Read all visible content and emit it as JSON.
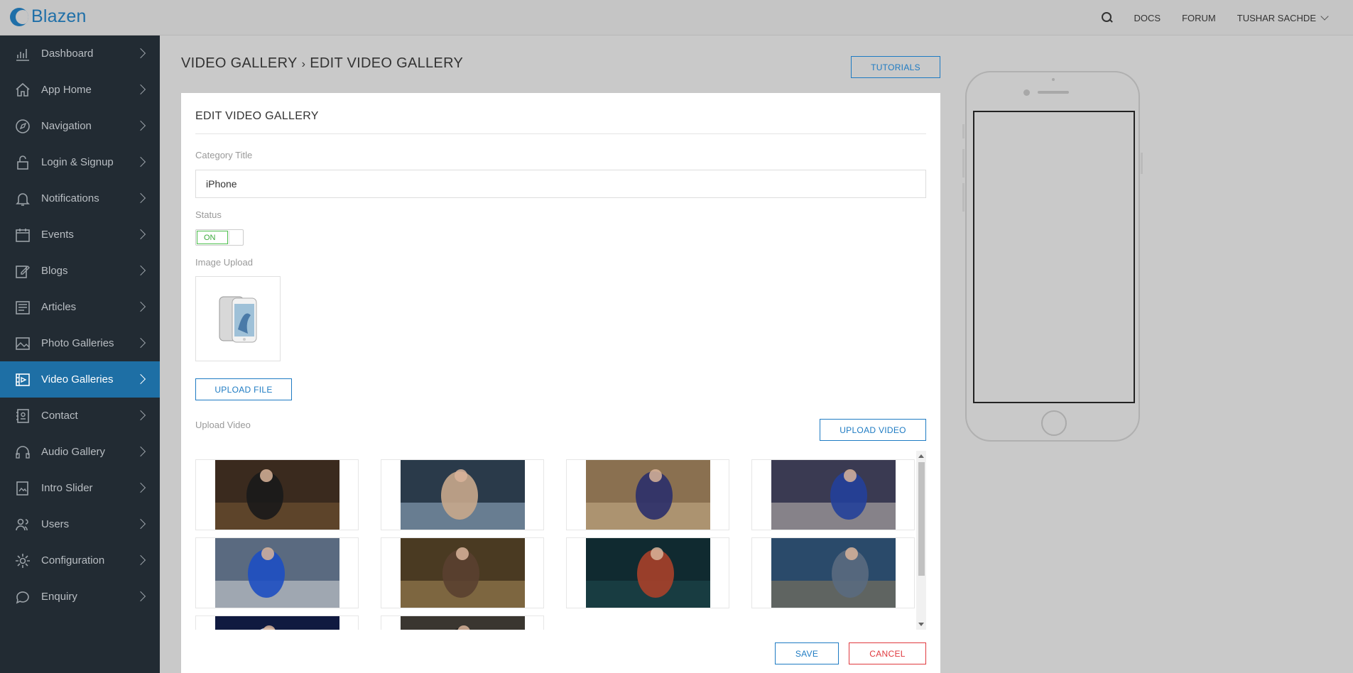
{
  "app": {
    "name": "Blazen",
    "brand_color": "#1f6fa8"
  },
  "topbar": {
    "search_icon": "search-icon",
    "links": [
      "DOCS",
      "FORUM"
    ],
    "user": "TUSHAR SACHDE"
  },
  "sidebar": {
    "active_color": "#1e6fa5",
    "items": [
      {
        "label": "Dashboard",
        "icon": "bar-chart-icon"
      },
      {
        "label": "App Home",
        "icon": "home-icon"
      },
      {
        "label": "Navigation",
        "icon": "compass-icon"
      },
      {
        "label": "Login & Signup",
        "icon": "lock-icon"
      },
      {
        "label": "Notifications",
        "icon": "bell-icon"
      },
      {
        "label": "Events",
        "icon": "calendar-icon"
      },
      {
        "label": "Blogs",
        "icon": "edit-icon"
      },
      {
        "label": "Articles",
        "icon": "newspaper-icon"
      },
      {
        "label": "Photo Galleries",
        "icon": "image-icon"
      },
      {
        "label": "Video Galleries",
        "icon": "film-icon",
        "active": true
      },
      {
        "label": "Contact",
        "icon": "contact-book-icon"
      },
      {
        "label": "Audio Gallery",
        "icon": "headphones-icon"
      },
      {
        "label": "Intro Slider",
        "icon": "slides-icon"
      },
      {
        "label": "Users",
        "icon": "users-icon"
      },
      {
        "label": "Configuration",
        "icon": "gear-icon"
      },
      {
        "label": "Enquiry",
        "icon": "chat-icon"
      }
    ]
  },
  "header": {
    "breadcrumb_parent": "VIDEO GALLERY",
    "breadcrumb_sep": "›",
    "breadcrumb_current": "EDIT VIDEO GALLERY",
    "tutorials_label": "TUTORIALS"
  },
  "form": {
    "title": "EDIT VIDEO GALLERY",
    "category_title_label": "Category Title",
    "category_title_value": "iPhone",
    "status_label": "Status",
    "status_value": "ON",
    "image_upload_label": "Image Upload",
    "upload_file_label": "UPLOAD FILE",
    "upload_video_section_label": "Upload Video",
    "upload_video_label": "UPLOAD VIDEO",
    "save_label": "SAVE",
    "cancel_label": "CANCEL",
    "cancel_color": "#e0393e",
    "on_color": "#3aa83a"
  },
  "videos": [
    {
      "name": "video-thumbnail"
    },
    {
      "name": "video-thumbnail"
    },
    {
      "name": "video-thumbnail"
    },
    {
      "name": "video-thumbnail"
    },
    {
      "name": "video-thumbnail"
    },
    {
      "name": "video-thumbnail"
    },
    {
      "name": "video-thumbnail"
    },
    {
      "name": "video-thumbnail"
    },
    {
      "name": "video-thumbnail"
    },
    {
      "name": "video-thumbnail"
    }
  ]
}
